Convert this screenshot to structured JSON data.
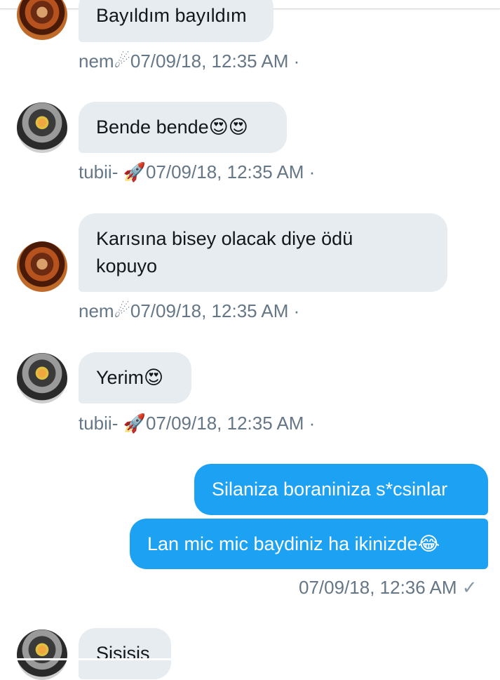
{
  "messages": [
    {
      "sender": "nem☄",
      "text": "Bayıldım bayıldım",
      "time": "07/09/18, 12:35 AM ·"
    },
    {
      "sender": "tubii- 🚀",
      "text": "Bende bende😍😍",
      "time": "07/09/18, 12:35 AM ·"
    },
    {
      "sender": "nem☄",
      "text_line1": "Karısına bisey olacak diye ödü",
      "text_line2": "kopuyo",
      "time": "07/09/18, 12:35 AM ·"
    },
    {
      "sender": "tubii- 🚀",
      "text": "Yerim😍",
      "time": "07/09/18, 12:35 AM ·"
    },
    {
      "text": "Silaniza boraniniza s*csinlar"
    },
    {
      "text": "Lan mic mic baydiniz ha ikinizde😂",
      "time": "07/09/18, 12:36 AM",
      "status": "✓"
    },
    {
      "text": "Sisisis"
    }
  ]
}
